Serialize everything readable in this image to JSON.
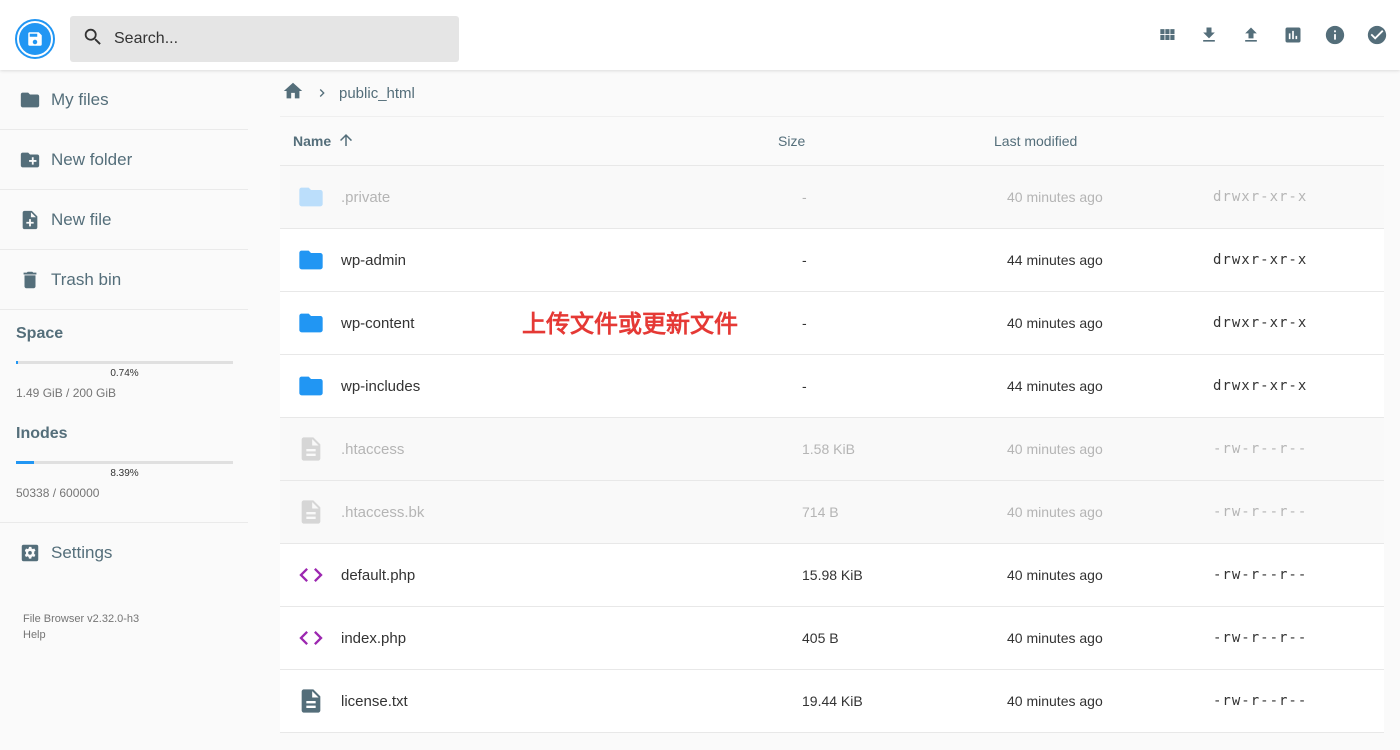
{
  "header": {
    "search_placeholder": "Search...",
    "actions": [
      "grid-view-icon",
      "download-icon",
      "upload-icon",
      "chart-icon",
      "info-icon",
      "select-icon"
    ]
  },
  "sidebar": {
    "items": [
      {
        "label": "My files"
      },
      {
        "label": "New folder"
      },
      {
        "label": "New file"
      },
      {
        "label": "Trash bin"
      }
    ],
    "space": {
      "title": "Space",
      "percent": "0.74%",
      "usage": "1.49 GiB / 200 GiB",
      "fill_fraction": 0.0074
    },
    "inodes": {
      "title": "Inodes",
      "percent": "8.39%",
      "usage": "50338 / 600000",
      "fill_fraction": 0.0839
    },
    "settings_label": "Settings",
    "version": "File Browser v2.32.0-h3",
    "help": "Help"
  },
  "breadcrumb": {
    "current": "public_html"
  },
  "table": {
    "headers": {
      "name": "Name",
      "size": "Size",
      "modified": "Last modified"
    },
    "rows": [
      {
        "type": "folder",
        "name": ".private",
        "size": "-",
        "modified": "40 minutes ago",
        "perm": "drwxr-xr-x",
        "hidden": true
      },
      {
        "type": "folder",
        "name": "wp-admin",
        "size": "-",
        "modified": "44 minutes ago",
        "perm": "drwxr-xr-x",
        "hidden": false
      },
      {
        "type": "folder",
        "name": "wp-content",
        "size": "-",
        "modified": "40 minutes ago",
        "perm": "drwxr-xr-x",
        "hidden": false
      },
      {
        "type": "folder",
        "name": "wp-includes",
        "size": "-",
        "modified": "44 minutes ago",
        "perm": "drwxr-xr-x",
        "hidden": false
      },
      {
        "type": "file",
        "name": ".htaccess",
        "size": "1.58 KiB",
        "modified": "40 minutes ago",
        "perm": "-rw-r--r--",
        "hidden": true
      },
      {
        "type": "file",
        "name": ".htaccess.bk",
        "size": "714 B",
        "modified": "40 minutes ago",
        "perm": "-rw-r--r--",
        "hidden": true
      },
      {
        "type": "code",
        "name": "default.php",
        "size": "15.98 KiB",
        "modified": "40 minutes ago",
        "perm": "-rw-r--r--",
        "hidden": false
      },
      {
        "type": "code",
        "name": "index.php",
        "size": "405 B",
        "modified": "40 minutes ago",
        "perm": "-rw-r--r--",
        "hidden": false
      },
      {
        "type": "text",
        "name": "license.txt",
        "size": "19.44 KiB",
        "modified": "40 minutes ago",
        "perm": "-rw-r--r--",
        "hidden": false
      }
    ]
  },
  "annotation": "上传文件或更新文件",
  "colors": {
    "accent": "#2196f3",
    "code": "#9c27b0",
    "annotation": "#e53935"
  }
}
